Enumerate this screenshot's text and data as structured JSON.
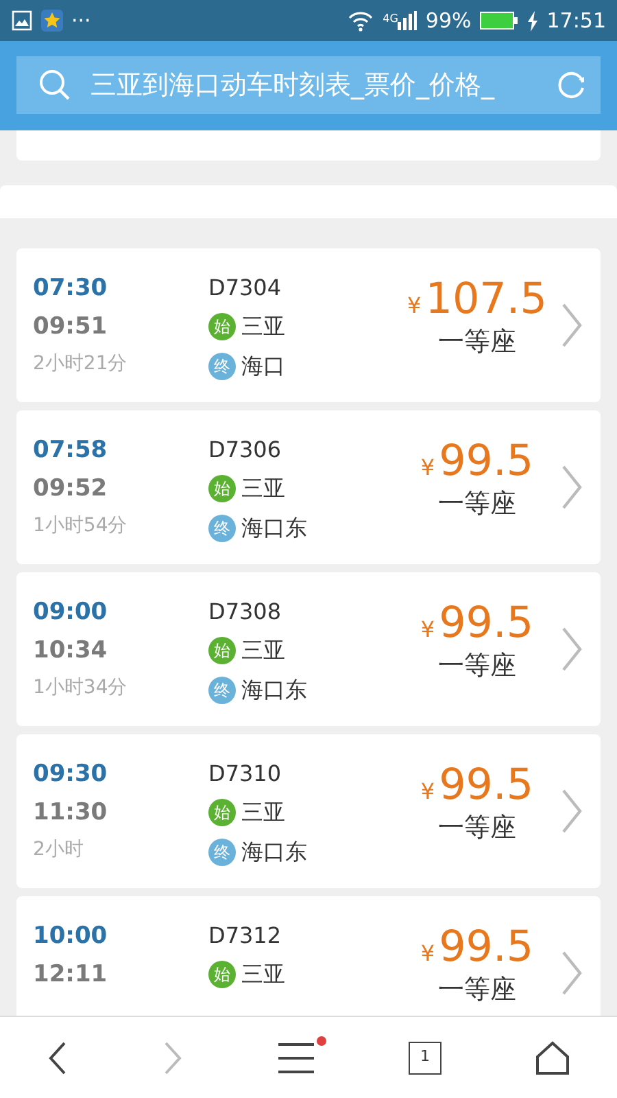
{
  "status_bar": {
    "more": "···",
    "network": "4G",
    "battery": "99%",
    "time": "17:51"
  },
  "search": {
    "value": "三亚到海口动车时刻表_票价_价格_"
  },
  "trains": [
    {
      "depart": "07:30",
      "arrive": "09:51",
      "duration": "2小时21分",
      "number": "D7304",
      "stations": [
        {
          "kind": "start",
          "badge": "始",
          "name": "三亚"
        },
        {
          "kind": "end",
          "badge": "终",
          "name": "海口"
        }
      ],
      "currency": "¥",
      "price": "107.5",
      "seat": "一等座"
    },
    {
      "depart": "07:58",
      "arrive": "09:52",
      "duration": "1小时54分",
      "number": "D7306",
      "stations": [
        {
          "kind": "start",
          "badge": "始",
          "name": "三亚"
        },
        {
          "kind": "end",
          "badge": "终",
          "name": "海口东"
        }
      ],
      "currency": "¥",
      "price": "99.5",
      "seat": "一等座"
    },
    {
      "depart": "09:00",
      "arrive": "10:34",
      "duration": "1小时34分",
      "number": "D7308",
      "stations": [
        {
          "kind": "start",
          "badge": "始",
          "name": "三亚"
        },
        {
          "kind": "end",
          "badge": "终",
          "name": "海口东"
        }
      ],
      "currency": "¥",
      "price": "99.5",
      "seat": "一等座"
    },
    {
      "depart": "09:30",
      "arrive": "11:30",
      "duration": "2小时",
      "number": "D7310",
      "stations": [
        {
          "kind": "start",
          "badge": "始",
          "name": "三亚"
        },
        {
          "kind": "end",
          "badge": "终",
          "name": "海口东"
        }
      ],
      "currency": "¥",
      "price": "99.5",
      "seat": "一等座"
    },
    {
      "depart": "10:00",
      "arrive": "12:11",
      "number": "D7312",
      "stations": [
        {
          "kind": "start",
          "badge": "始",
          "name": "三亚"
        }
      ],
      "currency": "¥",
      "price": "99.5",
      "seat": "一等座"
    }
  ],
  "bottom_nav": {
    "forward_disabled": true,
    "menu_notification": true,
    "tab_count": "1"
  }
}
